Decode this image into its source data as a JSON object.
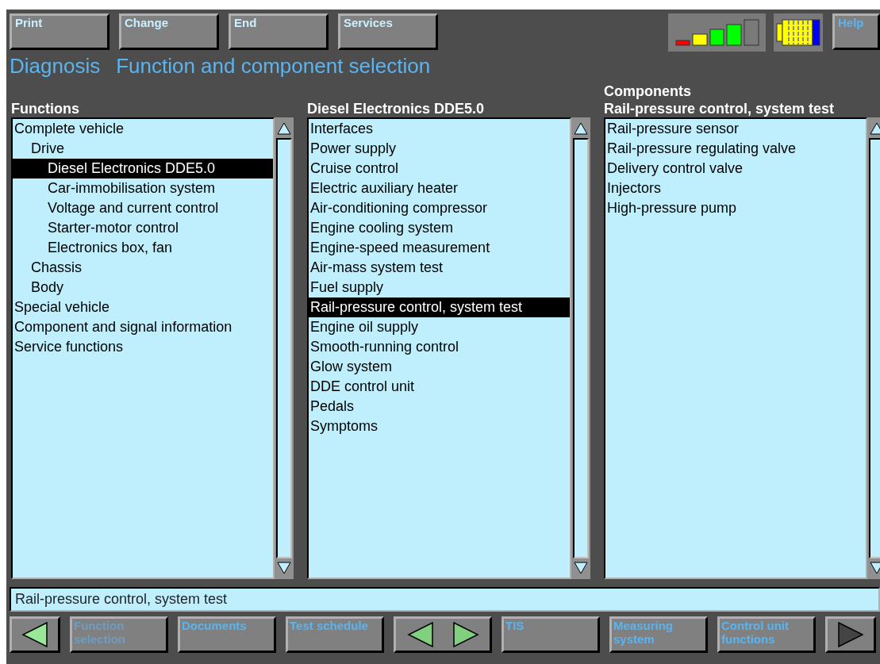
{
  "toolbar": [
    {
      "label": "Print",
      "kind": "command"
    },
    {
      "label": "Change",
      "kind": "command"
    },
    {
      "label": "End",
      "kind": "command"
    },
    {
      "label": "Services",
      "kind": "command"
    },
    {
      "label": "Help",
      "kind": "help"
    }
  ],
  "title": {
    "area": "Diagnosis",
    "screen": "Function and component selection"
  },
  "functions": {
    "heading": "Functions",
    "items": [
      {
        "label": "Complete vehicle",
        "selected": false,
        "children": [
          {
            "label": "Drive",
            "selected": false,
            "children": [
              {
                "label": "Diesel Electronics DDE5.0",
                "selected": true
              },
              {
                "label": "Car-immobilisation system",
                "selected": false
              },
              {
                "label": "Voltage and current control",
                "selected": false
              },
              {
                "label": "Starter-motor control",
                "selected": false
              },
              {
                "label": "Electronics box, fan",
                "selected": false
              }
            ]
          },
          {
            "label": "Chassis",
            "selected": false
          },
          {
            "label": "Body",
            "selected": false
          }
        ]
      },
      {
        "label": "Special vehicle",
        "selected": false
      },
      {
        "label": "Component and signal information",
        "selected": false
      },
      {
        "label": "Service functions",
        "selected": false
      }
    ]
  },
  "systems": {
    "heading": "Diesel Electronics DDE5.0",
    "items": [
      {
        "label": "Interfaces",
        "selected": false
      },
      {
        "label": "Power supply",
        "selected": false
      },
      {
        "label": "Cruise control",
        "selected": false
      },
      {
        "label": "Electric auxiliary heater",
        "selected": false
      },
      {
        "label": "Air-conditioning compressor",
        "selected": false
      },
      {
        "label": "Engine cooling system",
        "selected": false
      },
      {
        "label": "Engine-speed measurement",
        "selected": false
      },
      {
        "label": "Air-mass system test",
        "selected": false
      },
      {
        "label": "Fuel supply",
        "selected": false
      },
      {
        "label": "Rail-pressure control, system test",
        "selected": true
      },
      {
        "label": "Engine oil supply",
        "selected": false
      },
      {
        "label": "Smooth-running control",
        "selected": false
      },
      {
        "label": "Glow system",
        "selected": false
      },
      {
        "label": "DDE control unit",
        "selected": false
      },
      {
        "label": "Pedals",
        "selected": false
      },
      {
        "label": "Symptoms",
        "selected": false
      }
    ]
  },
  "components": {
    "title": "Components",
    "heading": "Rail-pressure control, system test",
    "items": [
      {
        "label": "Rail-pressure sensor",
        "selected": false
      },
      {
        "label": "Rail-pressure regulating valve",
        "selected": false
      },
      {
        "label": "Delivery control valve",
        "selected": false
      },
      {
        "label": "Injectors",
        "selected": false
      },
      {
        "label": "High-pressure pump",
        "selected": false
      }
    ]
  },
  "status_text": "Rail-pressure control, system test",
  "bottom_bar": [
    {
      "kind": "back",
      "disabled": false
    },
    {
      "kind": "text",
      "label": "Function selection",
      "disabled": true
    },
    {
      "kind": "text",
      "label": "Documents",
      "disabled": false
    },
    {
      "kind": "text",
      "label": "Test schedule",
      "disabled": false
    },
    {
      "kind": "pair",
      "disabled": false
    },
    {
      "kind": "text",
      "label": "TIS",
      "disabled": false
    },
    {
      "kind": "text",
      "label": "Measuring system",
      "disabled": false
    },
    {
      "kind": "text",
      "label": "Control unit functions",
      "disabled": false
    },
    {
      "kind": "forward",
      "disabled": true
    }
  ]
}
